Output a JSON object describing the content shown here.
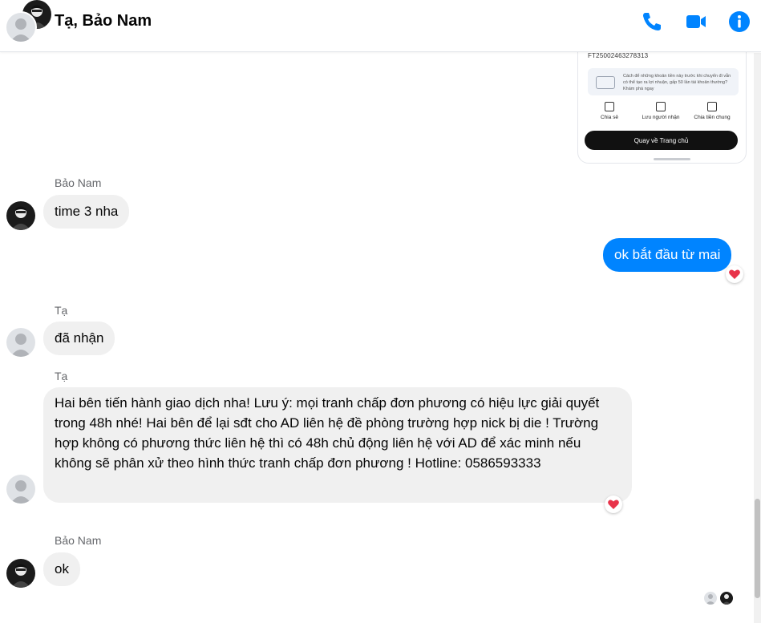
{
  "header": {
    "title": "Tạ, Bảo Nam",
    "icons": [
      "phone-icon",
      "video-call-icon",
      "info-icon"
    ],
    "accent": "#0084ff"
  },
  "attachment": {
    "transaction_code": "FT25002463278313",
    "note": "Cách để những khoản tiền này trước khi chuyển đi vẫn có thể tạo ra lợi nhuận, gấp 50 lần tài khoản thường? Khám phá ngay",
    "actions": [
      "Chia sẻ",
      "Lưu người nhận",
      "Chia tiền chung"
    ],
    "home_button": "Quay về Trang chủ"
  },
  "messages": [
    {
      "sender": "Bảo Nam",
      "text": "time 3 nha"
    },
    {
      "sender": "",
      "text": "ok bắt đầu từ mai",
      "reaction": "heart"
    },
    {
      "sender": "Tạ",
      "text": "đã nhận"
    },
    {
      "sender": "Tạ",
      "text": "Hai bên tiến hành giao dịch nha! Lưu ý: mọi tranh chấp đơn phương có hiệu lực giải quyết trong 48h nhé! Hai bên để lại sđt cho AD liên hệ đề phòng trường hợp nick bị die ! Trường hợp không có phương thức liên hệ thì có 48h chủ động liên hệ với AD để xác minh nếu không sẽ phân xử theo hình thức tranh chấp đơn phương ! Hotline: 0586593333",
      "reaction": "heart"
    },
    {
      "sender": "Bảo Nam",
      "text": "ok"
    }
  ],
  "colors": {
    "bubble_in": "#f0f0f0",
    "bubble_out": "#0084ff",
    "reaction_heart": "#e8334a"
  }
}
